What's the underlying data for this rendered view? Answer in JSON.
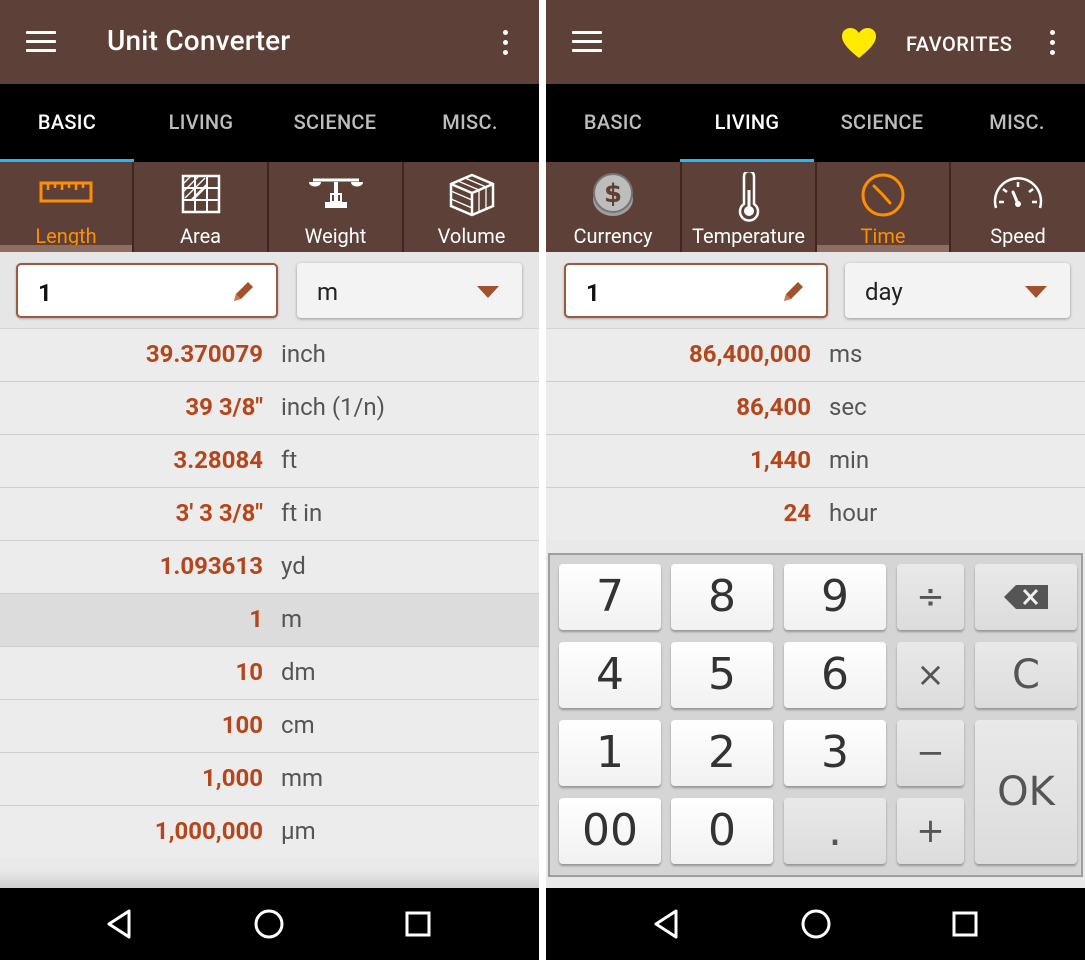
{
  "left": {
    "appbar": {
      "title": "Unit Converter"
    },
    "tabs": [
      {
        "label": "BASIC",
        "active": true
      },
      {
        "label": "LIVING",
        "active": false
      },
      {
        "label": "SCIENCE",
        "active": false
      },
      {
        "label": "MISC.",
        "active": false
      }
    ],
    "categories": [
      {
        "label": "Length",
        "icon": "ruler-icon",
        "active": true
      },
      {
        "label": "Area",
        "icon": "area-grid-icon",
        "active": false
      },
      {
        "label": "Weight",
        "icon": "scale-icon",
        "active": false
      },
      {
        "label": "Volume",
        "icon": "cube-icon",
        "active": false
      }
    ],
    "input": {
      "value": "1"
    },
    "unit_select": {
      "value": "m"
    },
    "results": [
      {
        "value": "39.370079",
        "unit": "inch"
      },
      {
        "value": "39 3/8\"",
        "unit": "inch (1/n)"
      },
      {
        "value": "3.28084",
        "unit": "ft"
      },
      {
        "value": "3' 3 3/8\"",
        "unit": "ft in"
      },
      {
        "value": "1.093613",
        "unit": "yd"
      },
      {
        "value": "1",
        "unit": "m",
        "highlighted": true
      },
      {
        "value": "10",
        "unit": "dm"
      },
      {
        "value": "100",
        "unit": "cm"
      },
      {
        "value": "1,000",
        "unit": "mm"
      },
      {
        "value": "1,000,000",
        "unit": "µm"
      }
    ]
  },
  "right": {
    "appbar": {
      "favorites_label": "FAVORITES",
      "favorite_color": "#ffea00"
    },
    "tabs": [
      {
        "label": "BASIC",
        "active": false
      },
      {
        "label": "LIVING",
        "active": true
      },
      {
        "label": "SCIENCE",
        "active": false
      },
      {
        "label": "MISC.",
        "active": false
      }
    ],
    "categories": [
      {
        "label": "Currency",
        "icon": "currency-coin-icon",
        "active": false
      },
      {
        "label": "Temperature",
        "icon": "thermometer-icon",
        "active": false
      },
      {
        "label": "Time",
        "icon": "clock-icon",
        "active": true
      },
      {
        "label": "Speed",
        "icon": "speedometer-icon",
        "active": false
      }
    ],
    "input": {
      "value": "1"
    },
    "unit_select": {
      "value": "day"
    },
    "results": [
      {
        "value": "86,400,000",
        "unit": "ms"
      },
      {
        "value": "86,400",
        "unit": "sec"
      },
      {
        "value": "1,440",
        "unit": "min"
      },
      {
        "value": "24",
        "unit": "hour"
      }
    ],
    "keypad": {
      "keys": [
        "7",
        "8",
        "9",
        "÷",
        "⌫",
        "4",
        "5",
        "6",
        "×",
        "C",
        "1",
        "2",
        "3",
        "−",
        "OK",
        "00",
        "0",
        ".",
        "+"
      ]
    }
  },
  "colors": {
    "appbar": "#5d4037",
    "accent_tab": "#29b6f6",
    "active_category": "#ff8f00",
    "result_value": "#b5451b"
  }
}
